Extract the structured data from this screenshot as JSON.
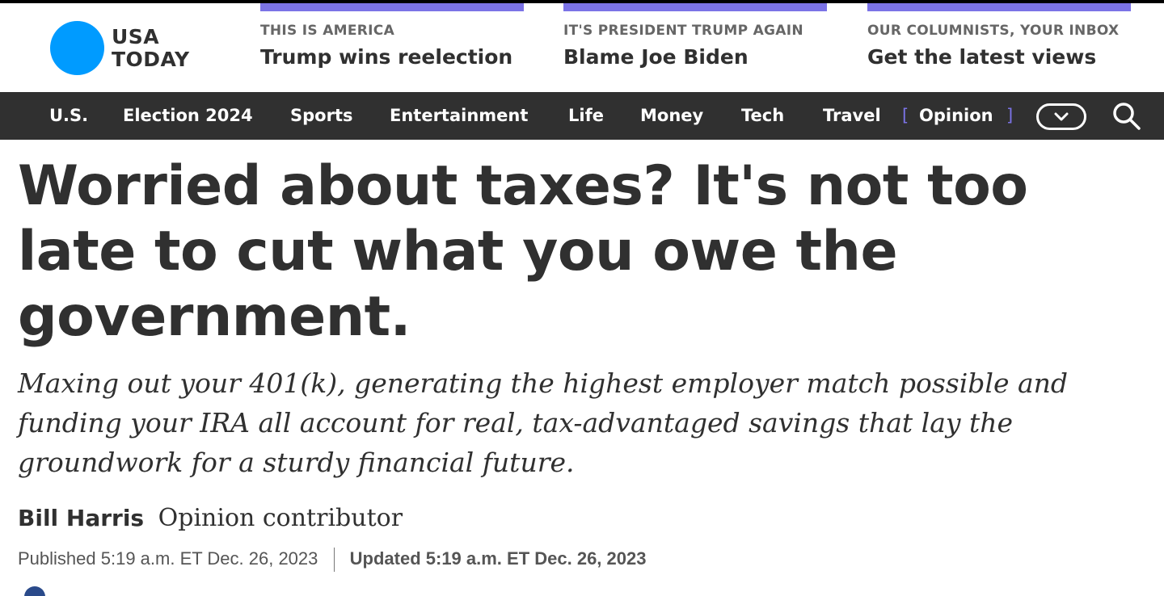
{
  "logo": {
    "line1": "USA",
    "line2": "TODAY",
    "brand_color": "#009bff"
  },
  "promos": [
    {
      "kicker": "THIS IS AMERICA",
      "headline": "Trump wins reelection"
    },
    {
      "kicker": "IT'S PRESIDENT TRUMP AGAIN",
      "headline": "Blame Joe Biden"
    },
    {
      "kicker": "OUR COLUMNISTS, YOUR INBOX",
      "headline": "Get the latest views"
    }
  ],
  "promo_accent": "#7b73e6",
  "nav": {
    "items": [
      "U.S.",
      "Election 2024",
      "Sports",
      "Entertainment",
      "Life",
      "Money",
      "Tech",
      "Travel"
    ],
    "opinion_open": "[",
    "opinion_label": "Opinion",
    "opinion_close": "]",
    "more_icon": "chevron-down-icon",
    "search_icon": "search-icon"
  },
  "article": {
    "headline": "Worried about taxes? It's not too late to cut what you owe the government.",
    "dek": "Maxing out your 401(k), generating the highest employer match possible and funding your IRA all account for real, tax-advantaged savings that lay the groundwork for a sturdy financial future.",
    "author": "Bill Harris",
    "role": "Opinion contributor",
    "published": "Published 5:19 a.m. ET Dec. 26, 2023",
    "updated": "Updated 5:19 a.m. ET Dec. 26, 2023"
  }
}
